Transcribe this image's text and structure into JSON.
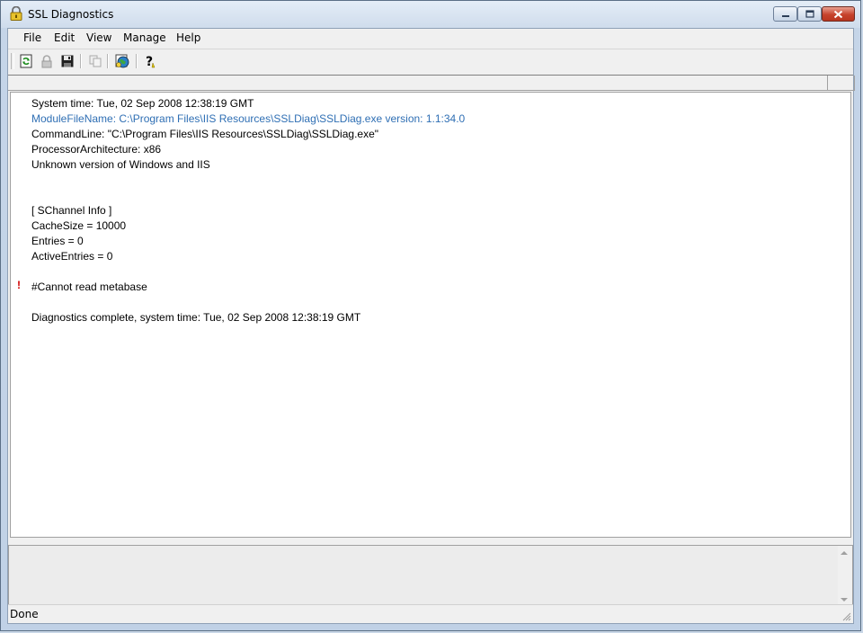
{
  "window": {
    "title": "SSL Diagnostics"
  },
  "menu": [
    "File",
    "Edit",
    "View",
    "Manage",
    "Help"
  ],
  "toolbar": {
    "buttons": [
      {
        "icon": "refresh-icon",
        "enabled": true
      },
      {
        "icon": "lock-icon",
        "enabled": false
      },
      {
        "icon": "save-icon",
        "enabled": true
      },
      {
        "icon": "copy-icon",
        "enabled": false
      },
      {
        "icon": "globe-icon",
        "enabled": true
      },
      {
        "icon": "help-icon",
        "enabled": true
      }
    ]
  },
  "log": {
    "lines": [
      {
        "text": "System time: Tue, 02 Sep 2008 12:38:19 GMT",
        "color": "#000000"
      },
      {
        "text": "ModuleFileName: C:\\Program Files\\IIS Resources\\SSLDiag\\SSLDiag.exe version: 1.1:34.0",
        "color": "#2f6fb4"
      },
      {
        "text": "CommandLine: \"C:\\Program Files\\IIS Resources\\SSLDiag\\SSLDiag.exe\"",
        "color": "#000000"
      },
      {
        "text": "ProcessorArchitecture: x86",
        "color": "#000000"
      },
      {
        "text": "Unknown version of Windows and IIS",
        "color": "#000000"
      },
      {
        "text": "[ SChannel Info ]",
        "color": "#000000"
      },
      {
        "text": "CacheSize = 10000",
        "color": "#000000"
      },
      {
        "text": "Entries = 0",
        "color": "#000000"
      },
      {
        "text": "ActiveEntries = 0",
        "color": "#000000"
      },
      {
        "text": "#Cannot read metabase",
        "color": "#000000",
        "warning": true,
        "marker": "!"
      },
      {
        "text": "Diagnostics complete, system time: Tue, 02 Sep 2008 12:38:19 GMT",
        "color": "#000000"
      }
    ]
  },
  "status": {
    "text": "Done"
  }
}
